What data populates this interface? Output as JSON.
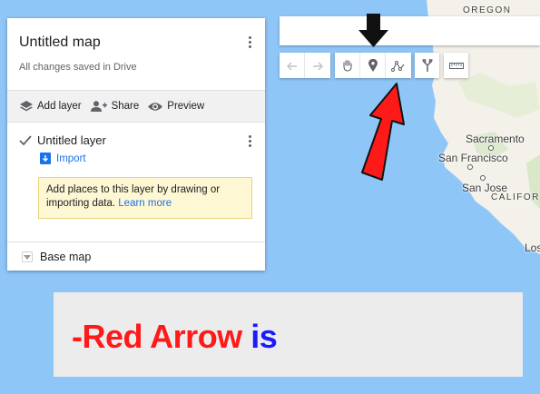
{
  "panel": {
    "title": "Untitled map",
    "status": "All changes saved in Drive",
    "actions": {
      "add_layer": "Add layer",
      "share": "Share",
      "preview": "Preview"
    },
    "layer": {
      "name": "Untitled layer",
      "import": "Import",
      "hint": "Add places to this layer by drawing or importing data.",
      "learn_more": "Learn more"
    },
    "base_map": "Base map"
  },
  "map_labels": {
    "oregon": "OREGON",
    "sacramento": "Sacramento",
    "san_francisco": "San Francisco",
    "san_jose": "San Jose",
    "california": "CALIFOR",
    "los": "Los"
  },
  "toolbar": {
    "tools": [
      "undo-icon",
      "redo-icon",
      "hand-icon",
      "marker-icon",
      "draw-line-icon",
      "directions-icon",
      "ruler-icon"
    ],
    "highlighted_tool": "marker-icon"
  },
  "annotation": {
    "prefix": "-",
    "red_text": "Red Arrow",
    "blue_text": "is"
  },
  "colors": {
    "water": "#8fc6f8",
    "land": "#f3f1e9",
    "red_arrow": "#ff1a1a",
    "black_arrow": "#111111",
    "banner_red": "#ff1a1a",
    "banner_blue": "#1a1aff",
    "link_blue": "#1a73e8"
  }
}
